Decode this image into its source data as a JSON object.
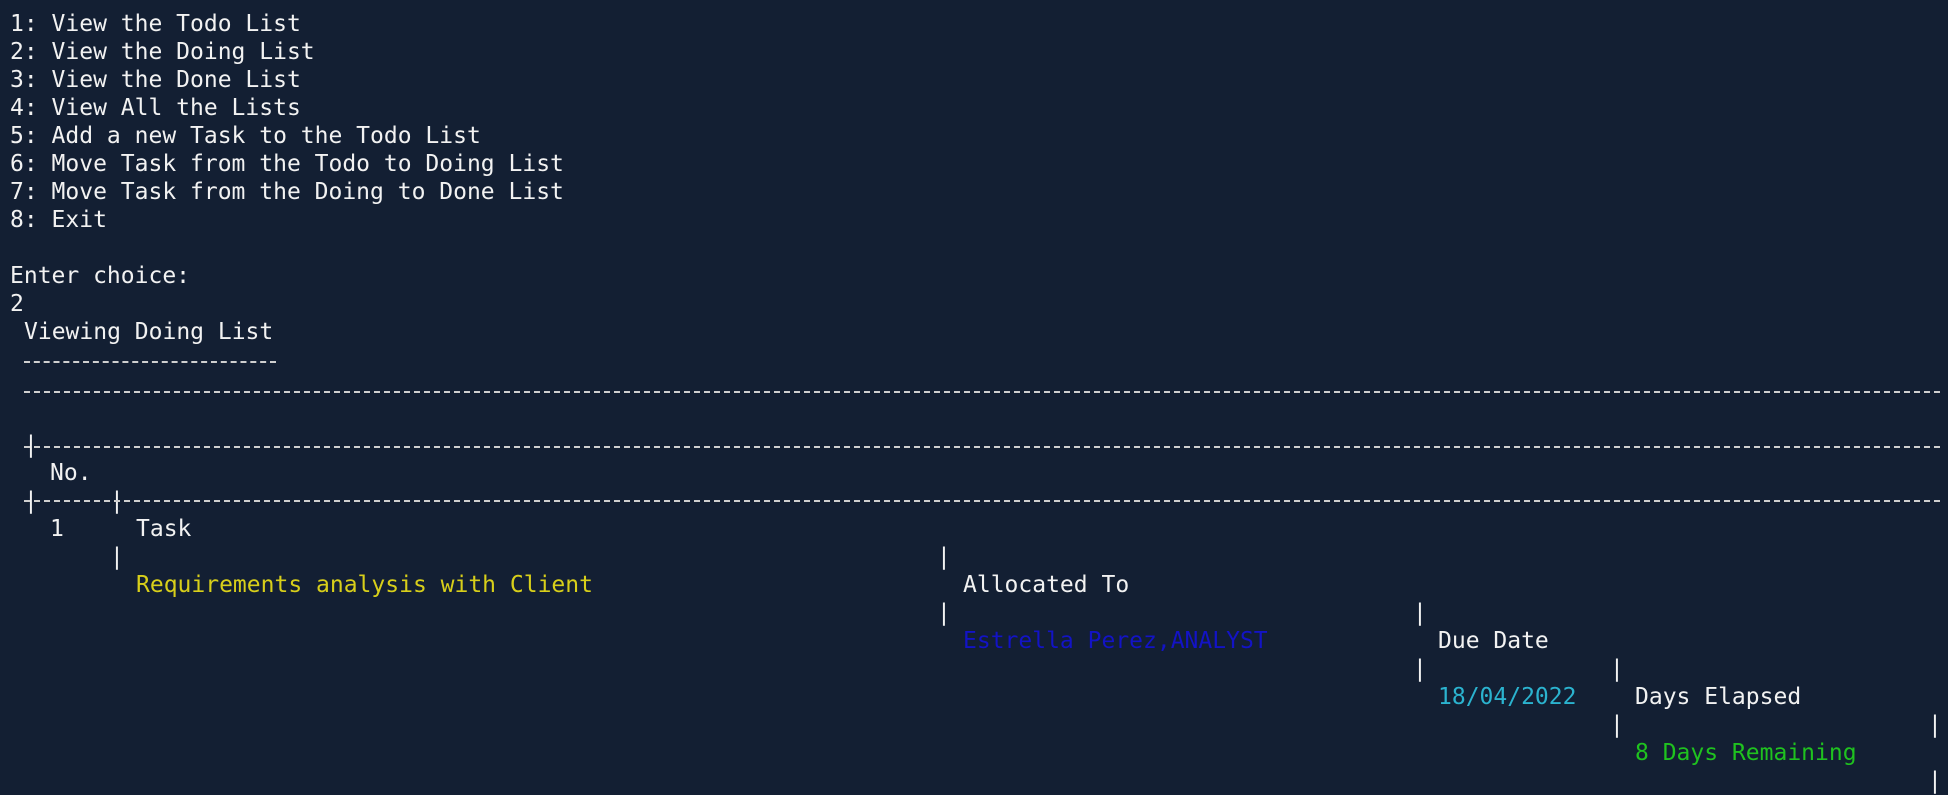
{
  "menu": {
    "items": [
      "1: View the Todo List",
      "2: View the Doing List",
      "3: View the Done List",
      "4: View All the Lists",
      "5: Add a new Task to the Todo List",
      "6: Move Task from the Todo to Doing List",
      "7: Move Task from the Doing to Done List",
      "8: Exit"
    ]
  },
  "prompt": {
    "label": "Enter choice:",
    "input": "2"
  },
  "section": {
    "title": "Viewing Doing List"
  },
  "table": {
    "headers": [
      "No.",
      "Task",
      "Allocated To",
      "Due Date",
      "Days Elapsed"
    ],
    "rows": [
      {
        "no": "1",
        "task": "Requirements analysis with Client",
        "allocated_to": "Estrella Perez,ANALYST",
        "due_date": "18/04/2022",
        "days_elapsed": "8 Days Remaining"
      }
    ]
  },
  "colors": {
    "background": "#131f33",
    "text": "#f2f2f2",
    "task": "#d8cf1a",
    "allocated": "#1313c6",
    "date": "#2bb3cf",
    "remaining": "#1fc21f"
  }
}
